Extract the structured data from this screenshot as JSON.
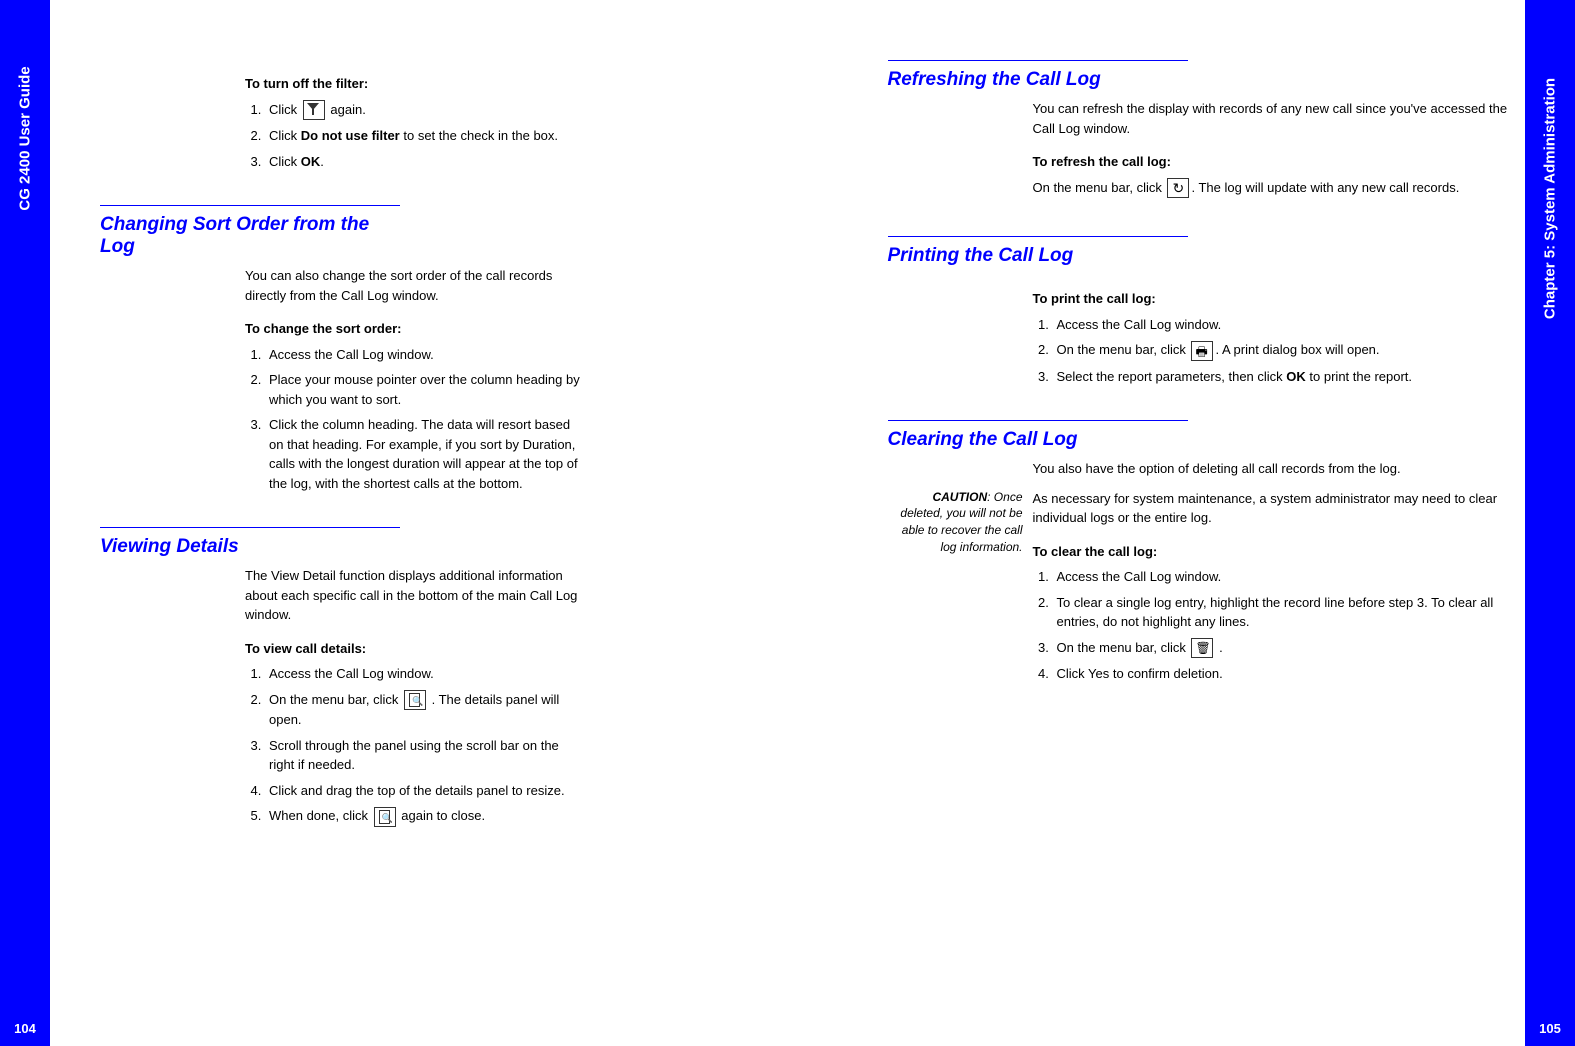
{
  "leftTab": {
    "label": "CG 2400 User Guide",
    "pageNumber": "104"
  },
  "rightTab": {
    "label": "Chapter 5: System Administration",
    "pageNumber": "105"
  },
  "left": {
    "turnOffFilter": {
      "heading": "To turn off the filter:",
      "step1a": "Click",
      "step1b": "again.",
      "step2a": "Click",
      "step2bold": "Do not use filter",
      "step2b": "to set the check in the box.",
      "step3a": "Click",
      "step3bold": "OK",
      "step3b": "."
    },
    "changingSort": {
      "title": "Changing Sort Order from the Log",
      "intro": "You can also change the sort order of the call records directly from the Call Log window.",
      "subhead": "To change the sort order:",
      "step1": "Access the Call Log window.",
      "step2": "Place your mouse pointer over the column heading by which you want to sort.",
      "step3": "Click the column heading. The data will resort based on that heading. For example, if you sort by Duration, calls with the longest duration will appear at the top of the log, with the shortest calls at the bottom."
    },
    "viewingDetails": {
      "title": "Viewing Details",
      "intro": "The View Detail function displays additional information about each specific call in the bottom of the main Call Log window.",
      "subhead": "To view call details:",
      "step1": "Access the Call Log window.",
      "step2a": "On the menu bar, click",
      "step2b": ". The details panel will open.",
      "step3": "Scroll through the panel using the scroll bar on the right if needed.",
      "step4": "Click and drag the top of the details panel to resize.",
      "step5a": "When done, click",
      "step5b": "again to close."
    }
  },
  "right": {
    "refreshing": {
      "title": "Refreshing the Call Log",
      "intro": "You can refresh the display with records of any new call since you've accessed the Call Log window.",
      "subhead": "To refresh the call log:",
      "text1a": "On the menu bar, click",
      "text1b": ". The log will update with any new call records."
    },
    "printing": {
      "title": "Printing the Call Log",
      "subhead": "To print the call log:",
      "step1": "Access the Call Log window.",
      "step2a": "On the menu bar, click",
      "step2b": ". A print dialog box will open.",
      "step3a": "Select the report parameters, then click",
      "step3bold": "OK",
      "step3b": "to print the report."
    },
    "clearing": {
      "title": "Clearing the Call Log",
      "intro": "You also have the option of deleting all call records from the log.",
      "cautionBold": "CAUTION",
      "cautionRest": ": Once deleted, you will not be able to recover the call log information.",
      "para": "As necessary for system maintenance, a system administrator may need to clear individual logs or the entire log.",
      "subhead": "To clear the call log:",
      "step1": "Access the Call Log window.",
      "step2": "To clear a single log entry, highlight the record line before step 3. To clear all entries, do not highlight any lines.",
      "step3a": "On the menu bar, click",
      "step3b": ".",
      "step4": "Click Yes to confirm deletion."
    }
  }
}
